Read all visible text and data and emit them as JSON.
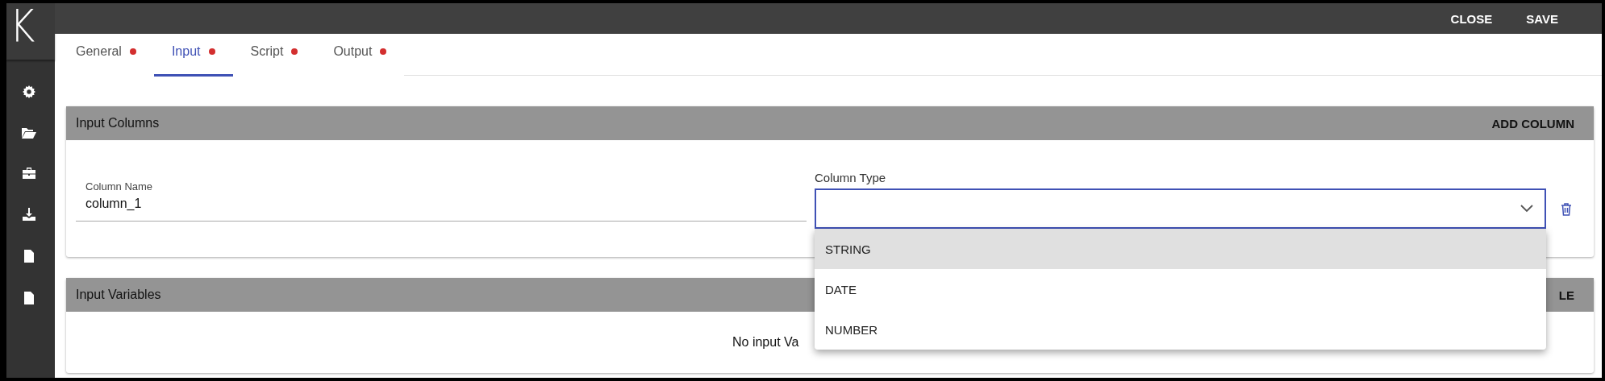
{
  "logo": "K",
  "top_actions": [
    "CLOSE",
    "SAVE"
  ],
  "sidebar": {
    "items": [
      {
        "kind": "gear"
      },
      {
        "kind": "folder"
      },
      {
        "kind": "briefcase"
      },
      {
        "kind": "download"
      },
      {
        "kind": "file"
      },
      {
        "kind": "file"
      }
    ]
  },
  "tabs": [
    {
      "label": "General",
      "selected": false,
      "color": "#d32f2f"
    },
    {
      "label": "Input",
      "selected": true,
      "color": "#d32f2f"
    },
    {
      "label": "Script",
      "selected": false,
      "color": "#d32f2f"
    },
    {
      "label": "Output",
      "selected": false,
      "color": "#d32f2f"
    }
  ],
  "input_columns": {
    "title": "Input Columns",
    "action": "ADD COLUMN",
    "rows": [
      {
        "name_label": "Column Name",
        "name_value": "column_1",
        "type_label": "Column Type",
        "type_value": "",
        "expanded": true,
        "options": [
          {
            "label": "STRING",
            "selected": true
          },
          {
            "label": "DATE",
            "selected": false
          },
          {
            "label": "NUMBER",
            "selected": false
          }
        ]
      }
    ]
  },
  "input_variables": {
    "title": "Input Variables",
    "action": "LE",
    "empty_text": "No input Va"
  }
}
